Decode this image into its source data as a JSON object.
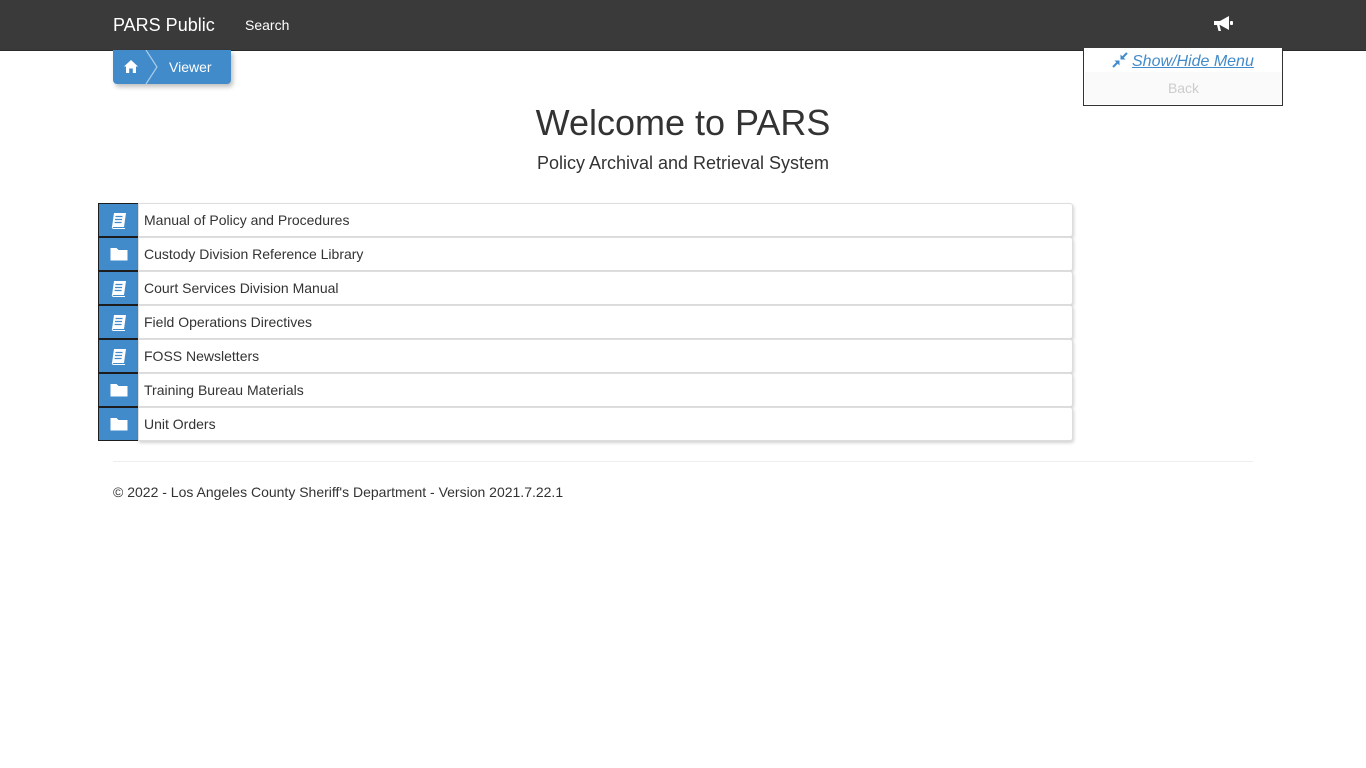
{
  "navbar": {
    "brand": "PARS Public",
    "search_link": "Search",
    "announcement_icon": "bullhorn-icon"
  },
  "breadcrumb": {
    "home_icon": "home-icon",
    "current": "Viewer"
  },
  "side_menu": {
    "toggle_icon": "compress-icon",
    "toggle_label": "Show/Hide Menu",
    "back_label": "Back"
  },
  "heading": {
    "title": "Welcome to PARS",
    "subtitle": "Policy Archival and Retrieval System"
  },
  "libraries": [
    {
      "label": "Manual of Policy and Procedures",
      "icon": "book-icon"
    },
    {
      "label": "Custody Division Reference Library",
      "icon": "folder-icon"
    },
    {
      "label": "Court Services Division Manual",
      "icon": "book-icon"
    },
    {
      "label": "Field Operations Directives",
      "icon": "book-icon"
    },
    {
      "label": "FOSS Newsletters",
      "icon": "book-icon"
    },
    {
      "label": "Training Bureau Materials",
      "icon": "folder-icon"
    },
    {
      "label": "Unit Orders",
      "icon": "folder-icon"
    }
  ],
  "footer": {
    "text": "© 2022 - Los Angeles County Sheriff's Department - Version 2021.7.22.1"
  },
  "colors": {
    "navbar_bg": "#3a3a3a",
    "accent": "#428bca",
    "link": "#428bca",
    "disabled_text": "#cccccc"
  }
}
